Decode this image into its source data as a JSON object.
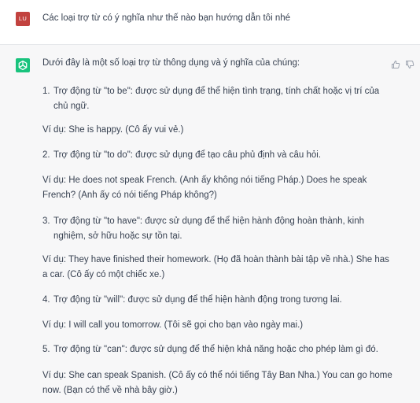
{
  "user": {
    "avatar_initials": "LU",
    "avatar_color": "#c2423f",
    "message": "Các loại trợ từ có ý nghĩa như thế nào bạn hướng dẫn tôi nhé"
  },
  "assistant": {
    "avatar_icon": "openai-logo-icon",
    "avatar_color": "#19c37d",
    "intro": "Dưới đây là một số loại trợ từ thông dụng và ý nghĩa của chúng:",
    "items": [
      {
        "number": "1.",
        "text": "Trợ động từ \"to be\": được sử dụng để thể hiện tình trạng, tính chất hoặc vị trí của chủ ngữ.",
        "example": "Ví dụ: She is happy. (Cô ấy vui vẻ.)"
      },
      {
        "number": "2.",
        "text": "Trợ động từ \"to do\": được sử dụng để tạo câu phủ định và câu hỏi.",
        "example": "Ví dụ: He does not speak French. (Anh ấy không nói tiếng Pháp.) Does he speak French? (Anh ấy có nói tiếng Pháp không?)"
      },
      {
        "number": "3.",
        "text": "Trợ động từ \"to have\": được sử dụng để thể hiện hành động hoàn thành, kinh nghiệm, sở hữu hoặc sự tồn tại.",
        "example": "Ví dụ: They have finished their homework. (Họ đã hoàn thành bài tập về nhà.) She has a car. (Cô ấy có một chiếc xe.)"
      },
      {
        "number": "4.",
        "text": "Trợ động từ \"will\": được sử dụng để thể hiện hành động trong tương lai.",
        "example": "Ví dụ: I will call you tomorrow. (Tôi sẽ gọi cho bạn vào ngày mai.)"
      },
      {
        "number": "5.",
        "text": "Trợ động từ \"can\": được sử dụng để thể hiện khả năng hoặc cho phép làm gì đó.",
        "example": "Ví dụ: She can speak Spanish. (Cô ấy có thể nói tiếng Tây Ban Nha.) You can go home now. (Bạn có thể về nhà bây giờ.)"
      }
    ],
    "feedback_icons": [
      "thumbs-up-icon",
      "thumbs-down-icon"
    ]
  }
}
